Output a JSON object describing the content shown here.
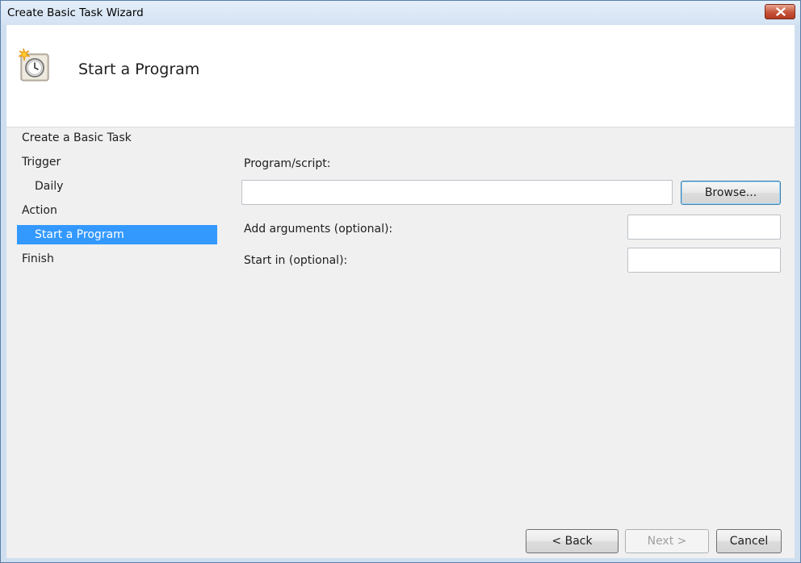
{
  "window": {
    "title": "Create Basic Task Wizard"
  },
  "header": {
    "title": "Start a Program",
    "icon": "scheduled-task-clock-icon"
  },
  "steps": [
    {
      "label": "Create a Basic Task"
    },
    {
      "label": "Trigger"
    },
    {
      "label": "Daily"
    },
    {
      "label": "Action"
    },
    {
      "label": "Start a Program"
    },
    {
      "label": "Finish"
    }
  ],
  "form": {
    "program_label": "Program/script:",
    "program_value": "",
    "browse_label": "Browse...",
    "arguments_label": "Add arguments (optional):",
    "arguments_value": "",
    "start_in_label": "Start in (optional):",
    "start_in_value": ""
  },
  "footer": {
    "back_label": "< Back",
    "next_label": "Next >",
    "cancel_label": "Cancel"
  },
  "colors": {
    "selection": "#3399ff",
    "close_button": "#c6533a",
    "frame": "#cfdff0"
  }
}
